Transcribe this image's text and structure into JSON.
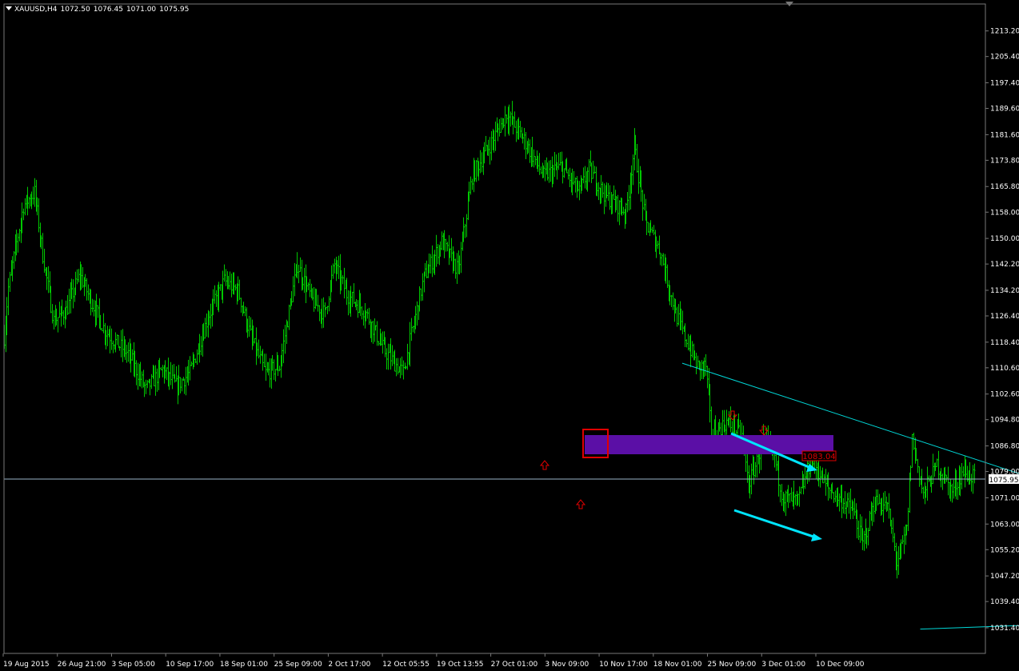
{
  "header": {
    "symbol": "XAUUSD,H4",
    "open": "1072.50",
    "high": "1076.45",
    "low": "1071.00",
    "close": "1075.95"
  },
  "colors": {
    "background": "#000000",
    "candles": "#00c800",
    "trendline": "#00d8d8",
    "arrow": "#00e5ff",
    "zone": "#5b0fa6",
    "marker": "#e00000",
    "price_line": "#9ab4c8"
  },
  "chart_data": {
    "type": "line",
    "title": "XAUUSD,H4",
    "ylim": [
      1023.6,
      1221.4
    ],
    "y_ticks": [
      "1213.20",
      "1205.40",
      "1197.40",
      "1189.60",
      "1181.60",
      "1173.80",
      "1165.80",
      "1158.00",
      "1150.00",
      "1142.20",
      "1134.20",
      "1126.40",
      "1118.40",
      "1110.60",
      "1102.60",
      "1094.80",
      "1086.80",
      "1079.00",
      "1071.00",
      "1063.00",
      "1055.20",
      "1047.20",
      "1039.40",
      "1031.40"
    ],
    "x_ticks": [
      "19 Aug 2015",
      "26 Aug 21:00",
      "3 Sep 05:00",
      "10 Sep 17:00",
      "18 Sep 01:00",
      "25 Sep 09:00",
      "2 Oct 17:00",
      "12 Oct 05:55",
      "19 Oct 13:55",
      "27 Oct 01:00",
      "3 Nov 09:00",
      "10 Nov 17:00",
      "18 Nov 01:00",
      "25 Nov 09:00",
      "3 Dec 01:00",
      "10 Dec 09:00"
    ],
    "current_price": "1075.95",
    "level_label": "1083.04",
    "anchors": [
      [
        0,
        1120
      ],
      [
        3,
        1135
      ],
      [
        14,
        1160
      ],
      [
        22,
        1164
      ],
      [
        28,
        1145
      ],
      [
        36,
        1125
      ],
      [
        45,
        1128
      ],
      [
        55,
        1139
      ],
      [
        62,
        1132
      ],
      [
        73,
        1122
      ],
      [
        82,
        1118
      ],
      [
        90,
        1115
      ],
      [
        103,
        1104
      ],
      [
        115,
        1110
      ],
      [
        125,
        1105
      ],
      [
        135,
        1109
      ],
      [
        148,
        1126
      ],
      [
        160,
        1137
      ],
      [
        170,
        1134
      ],
      [
        180,
        1119
      ],
      [
        190,
        1109
      ],
      [
        200,
        1111
      ],
      [
        213,
        1142
      ],
      [
        224,
        1131
      ],
      [
        233,
        1127
      ],
      [
        240,
        1142
      ],
      [
        249,
        1133
      ],
      [
        262,
        1128
      ],
      [
        276,
        1116
      ],
      [
        290,
        1109
      ],
      [
        305,
        1138
      ],
      [
        318,
        1149
      ],
      [
        330,
        1140
      ],
      [
        340,
        1169
      ],
      [
        355,
        1180
      ],
      [
        365,
        1188
      ],
      [
        378,
        1180
      ],
      [
        392,
        1169
      ],
      [
        405,
        1172
      ],
      [
        418,
        1164
      ],
      [
        425,
        1171
      ],
      [
        437,
        1163
      ],
      [
        452,
        1158
      ],
      [
        458,
        1178
      ],
      [
        466,
        1155
      ],
      [
        477,
        1146
      ],
      [
        488,
        1127
      ],
      [
        495,
        1120
      ],
      [
        504,
        1111
      ],
      [
        510,
        1111
      ],
      [
        514,
        1090
      ],
      [
        525,
        1094
      ],
      [
        536,
        1090
      ],
      [
        541,
        1075
      ],
      [
        552,
        1088
      ],
      [
        559,
        1085
      ],
      [
        566,
        1071
      ],
      [
        577,
        1070
      ],
      [
        587,
        1083
      ],
      [
        598,
        1074
      ],
      [
        607,
        1071
      ],
      [
        617,
        1067
      ],
      [
        624,
        1057
      ],
      [
        633,
        1070
      ],
      [
        642,
        1068
      ],
      [
        649,
        1051
      ],
      [
        656,
        1061
      ],
      [
        660,
        1089
      ],
      [
        668,
        1072
      ],
      [
        678,
        1081
      ],
      [
        689,
        1073
      ],
      [
        697,
        1079
      ],
      [
        705,
        1077
      ]
    ],
    "trendlines": [
      {
        "from": [
          493,
          1112
        ],
        "to": [
          930,
          1052
        ]
      },
      {
        "from": [
          666,
          1031
        ],
        "to": [
          1232,
          1039.5
        ]
      }
    ]
  }
}
